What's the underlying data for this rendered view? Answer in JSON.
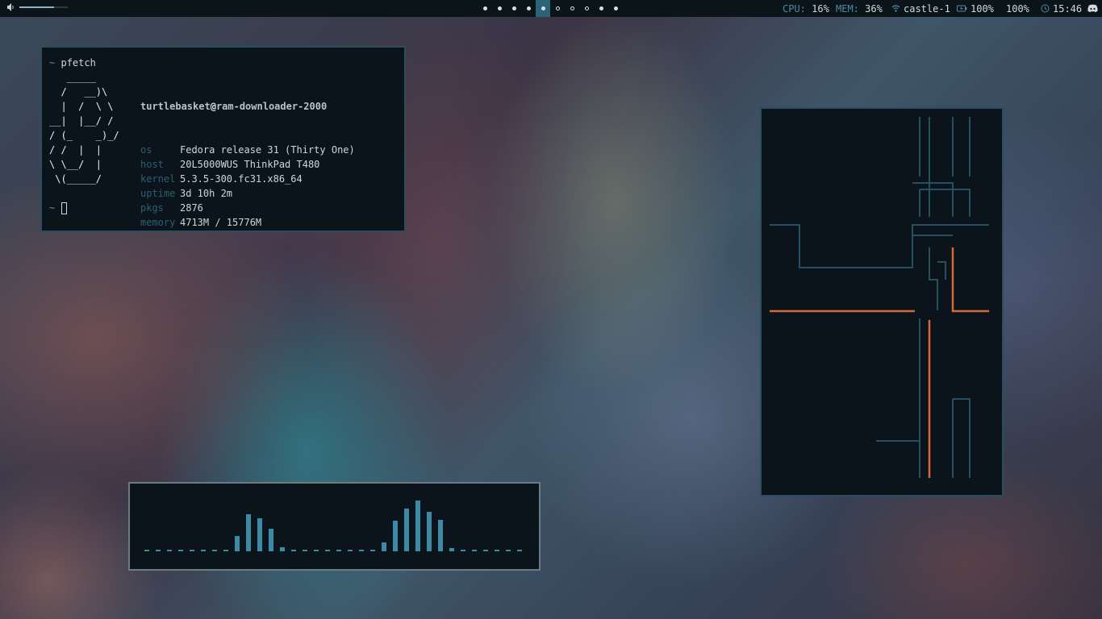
{
  "topbar": {
    "volume": {
      "icon": "speaker-icon",
      "level": 0.72
    },
    "workspaces": [
      {
        "state": "occupied"
      },
      {
        "state": "occupied"
      },
      {
        "state": "occupied"
      },
      {
        "state": "occupied"
      },
      {
        "state": "active"
      },
      {
        "state": "empty"
      },
      {
        "state": "empty"
      },
      {
        "state": "empty"
      },
      {
        "state": "occupied"
      },
      {
        "state": "occupied"
      }
    ],
    "cpu": {
      "label": "CPU:",
      "value": "16%"
    },
    "mem": {
      "label": "MEM:",
      "value": "36%"
    },
    "wifi": {
      "icon": "wifi-icon",
      "ssid": "castle-1"
    },
    "battery": {
      "icon": "battery-icon",
      "value": "100%"
    },
    "brightness": {
      "value": "100%"
    },
    "clock": {
      "icon": "clock-icon",
      "time": "15:46"
    },
    "discord": {
      "icon": "discord-icon"
    }
  },
  "terminal": {
    "prompt_symbol": "~",
    "command": "pfetch",
    "ascii": [
      "   _____",
      "  /   __)\\",
      "  |  /  \\ \\",
      "__|  |__/ /",
      "/ (_    _)_/",
      "/ /  |  |",
      "\\ \\__/  |",
      " \\(_____/"
    ],
    "user": "turtlebasket",
    "at": "@",
    "host_name": "ram-downloader-2000",
    "info": [
      {
        "key": "os",
        "value": "Fedora release 31 (Thirty One)"
      },
      {
        "key": "host",
        "value": "20L5000WUS ThinkPad T480"
      },
      {
        "key": "kernel",
        "value": "5.3.5-300.fc31.x86_64"
      },
      {
        "key": "uptime",
        "value": "3d 10h 2m"
      },
      {
        "key": "pkgs",
        "value": "2876"
      },
      {
        "key": "memory",
        "value": "4713M / 15776M"
      }
    ]
  },
  "pipes": {
    "colors": {
      "dim": "#24505f",
      "bright": "#d4693a"
    }
  },
  "visualizer": {
    "color": "#3d8aa6",
    "levels": [
      0.03,
      0.03,
      0.03,
      0.03,
      0.03,
      0.03,
      0.03,
      0.03,
      0.25,
      0.62,
      0.55,
      0.38,
      0.07,
      0.03,
      0.03,
      0.03,
      0.03,
      0.03,
      0.03,
      0.03,
      0.03,
      0.15,
      0.52,
      0.72,
      0.85,
      0.66,
      0.53,
      0.05,
      0.03,
      0.03,
      0.03,
      0.03,
      0.03,
      0.03
    ]
  }
}
